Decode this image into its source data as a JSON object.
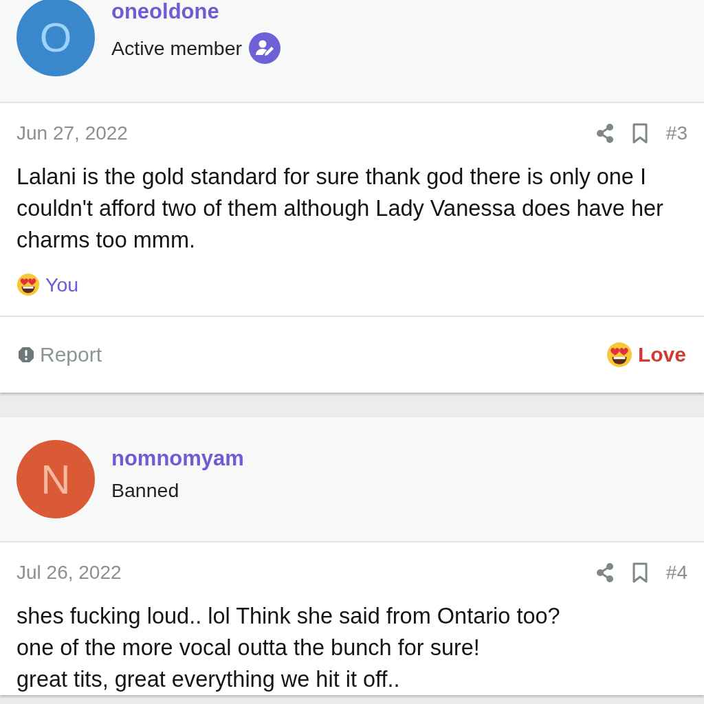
{
  "posts": [
    {
      "user": {
        "initial": "O",
        "color": "#3b87cc",
        "name": "oneoldone",
        "title": "Active member",
        "verified_badge": true
      },
      "date": "Jun 27, 2022",
      "number": "#3",
      "lines": [
        "Lalani is the gold standard for sure thank god there is only one I",
        "couldn't afford two of them although Lady Vanessa does have her",
        "charms too mmm."
      ],
      "reactions": {
        "text": "You"
      },
      "footer": {
        "report": "Report",
        "reaction": "Love",
        "reacted": true
      }
    },
    {
      "user": {
        "initial": "N",
        "color": "#d95a35",
        "name": "nomnomyam",
        "title": "Banned",
        "verified_badge": false
      },
      "date": "Jul 26, 2022",
      "number": "#4",
      "lines": [
        "shes fucking loud.. lol Think she said from Ontario too?",
        "one of the more vocal outta the bunch for sure!",
        "great tits, great everything we hit it off.."
      ]
    }
  ]
}
